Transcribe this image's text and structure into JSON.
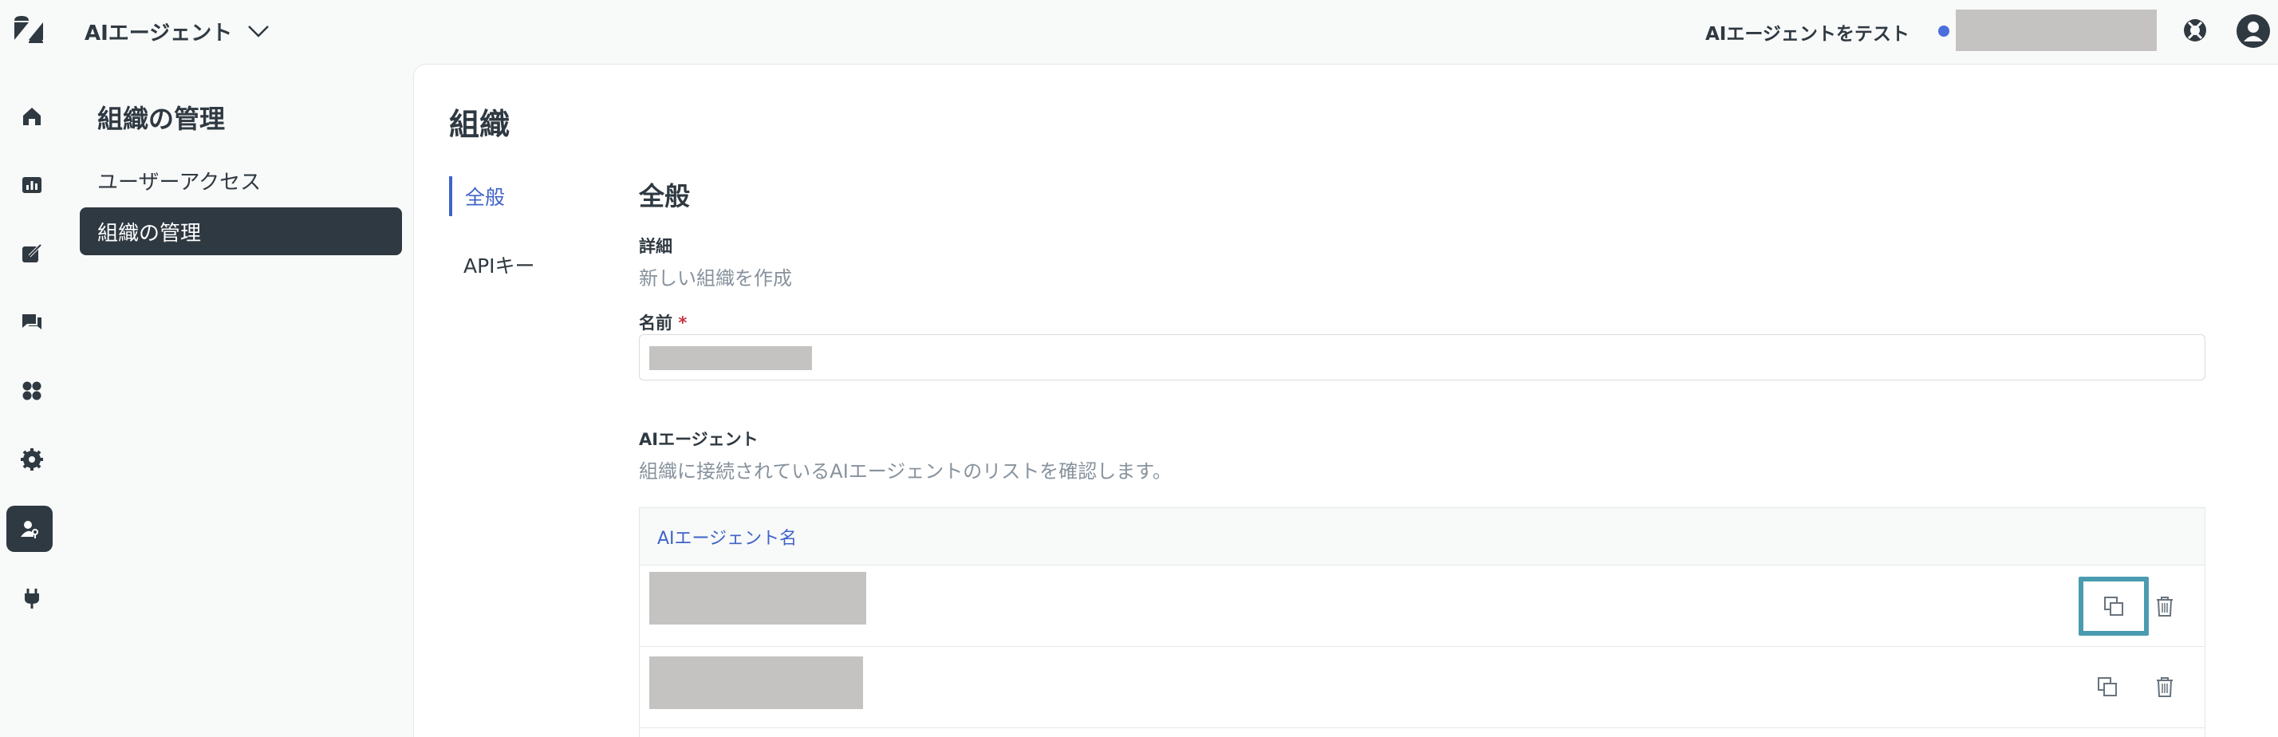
{
  "app": {
    "product_name": "AIエージェント",
    "test_agent_label": "AIエージェントをテスト"
  },
  "sidebar": {
    "icons": [
      "home-icon",
      "analytics-icon",
      "content-icon",
      "conversations-icon",
      "integrations-icon",
      "settings-icon",
      "admin-icon",
      "plug-icon"
    ],
    "active_icon": "admin-icon"
  },
  "secondary_nav": {
    "title": "組織の管理",
    "items": [
      {
        "label": "ユーザーアクセス",
        "active": false
      },
      {
        "label": "組織の管理",
        "active": true
      }
    ]
  },
  "main": {
    "page_title": "組織",
    "subnav": [
      {
        "label": "全般",
        "active": true
      },
      {
        "label": "APIキー",
        "active": false
      }
    ],
    "section_title": "全般",
    "details": {
      "label": "詳細",
      "description": "新しい組織を作成"
    },
    "name_field": {
      "label": "名前",
      "required_marker": "*"
    },
    "agents": {
      "label": "AIエージェント",
      "description": "組織に接続されているAIエージェントのリストを確認します。",
      "table": {
        "column_header": "AIエージェント名",
        "rows": 2
      }
    }
  },
  "colors": {
    "accent": "#3f63c8",
    "nav_active_bg": "#2f3941",
    "focus_ring": "#4a9bb0",
    "status_dot": "#4a6fdc"
  }
}
